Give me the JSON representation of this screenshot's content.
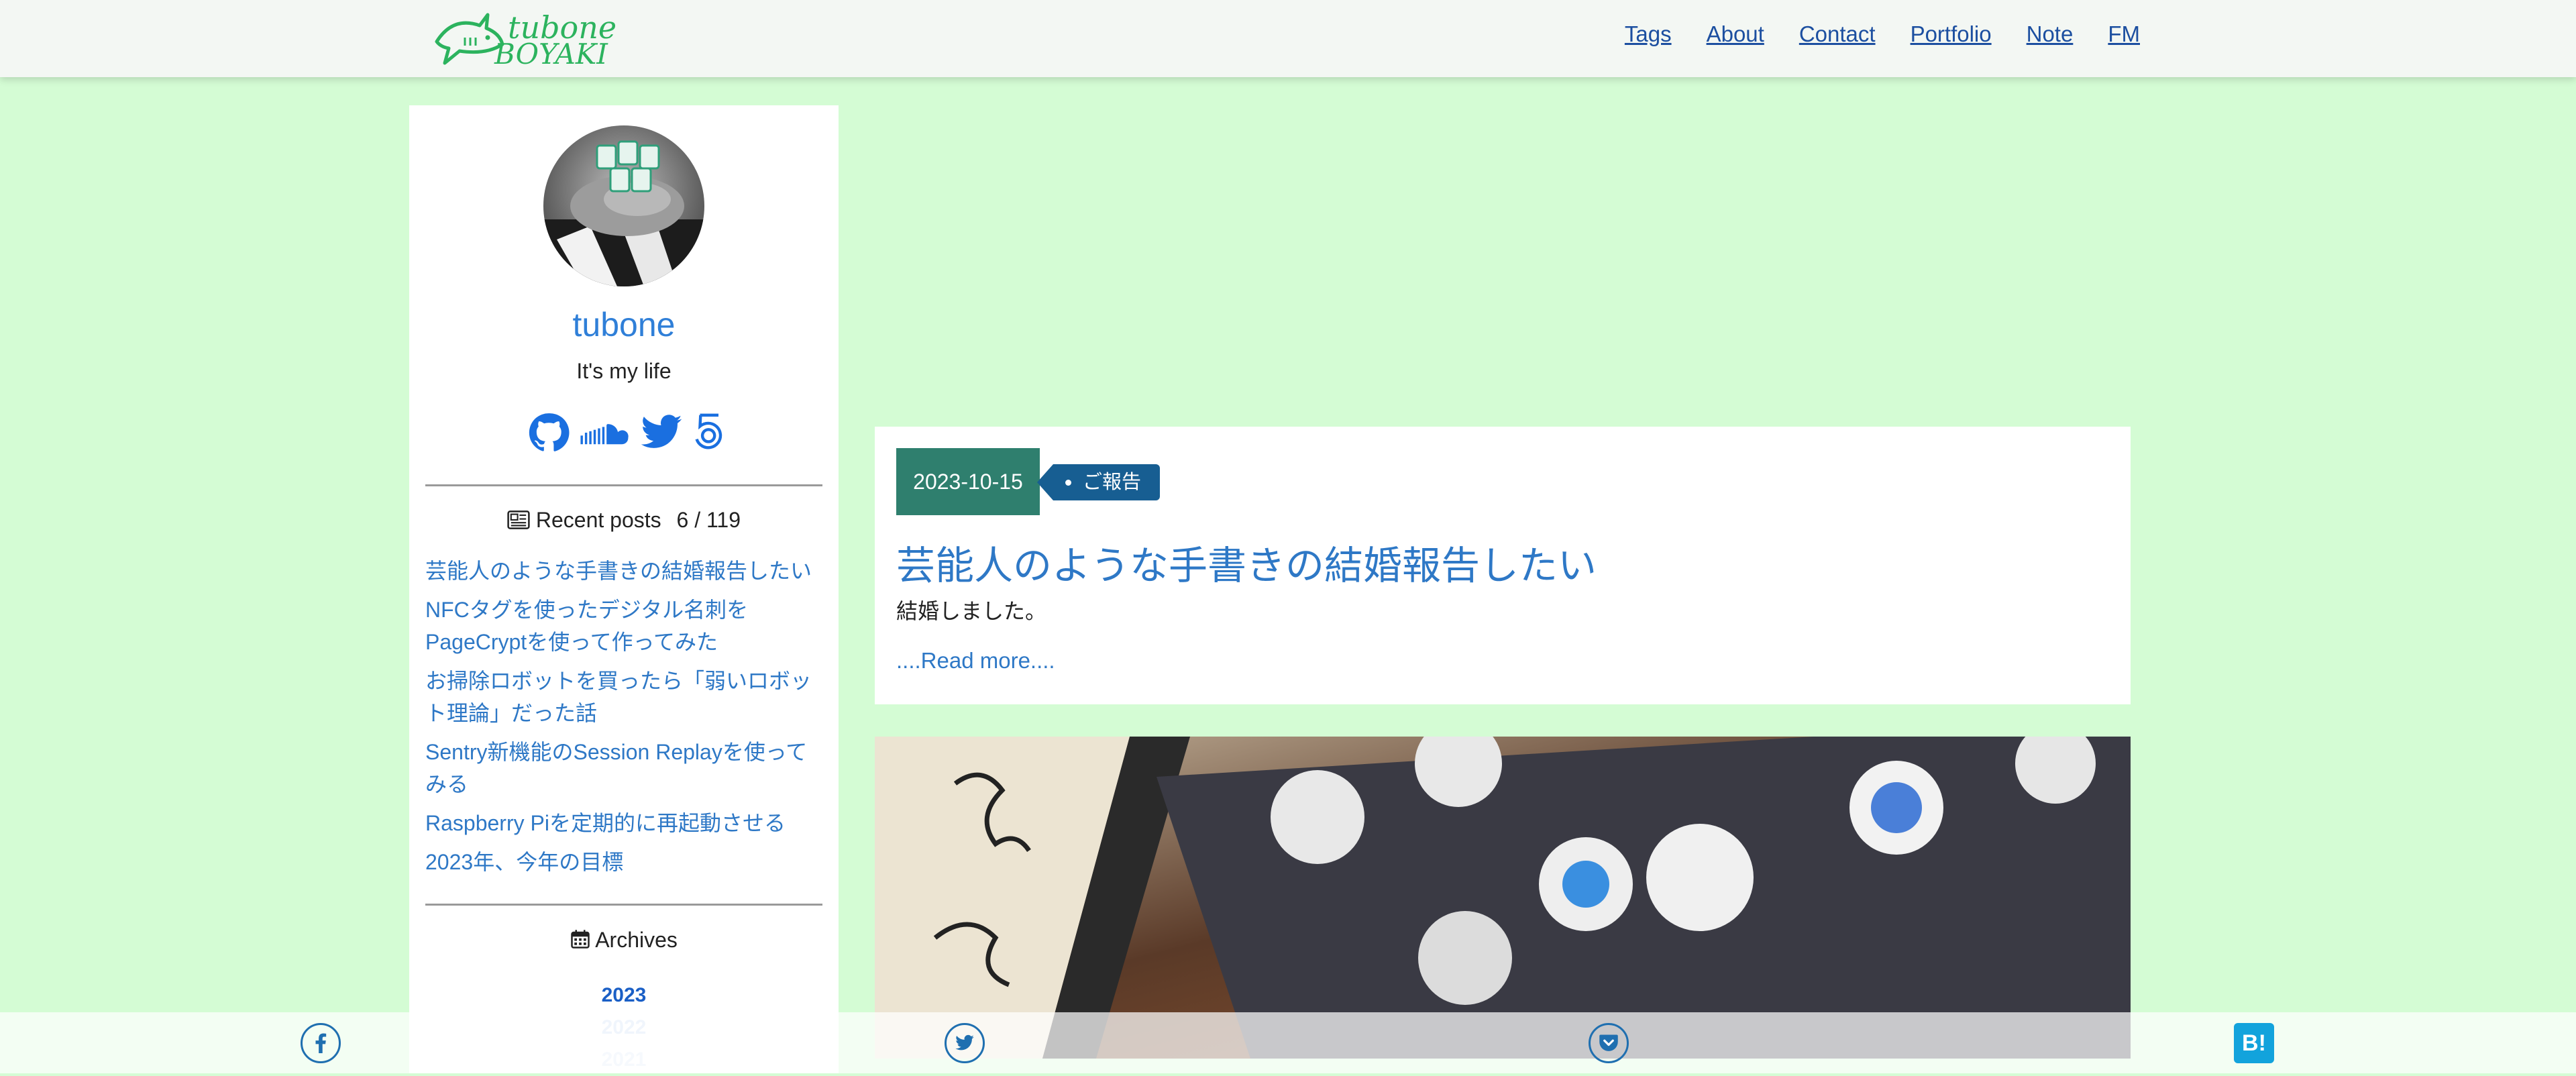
{
  "site": {
    "logo_line1": "tubone",
    "logo_line2": "BOYAKI"
  },
  "nav": {
    "items": [
      "Tags",
      "About",
      "Contact",
      "Portfolio",
      "Note",
      "FM"
    ]
  },
  "profile": {
    "name": "tubone",
    "description": "It's my life",
    "social_icons": [
      "github-icon",
      "soundcloud-icon",
      "twitter-icon",
      "500px-icon"
    ]
  },
  "recent": {
    "icon": "newspaper-icon",
    "title": "Recent posts",
    "count": "6 / 119",
    "items": [
      "芸能人のような手書きの結婚報告したい",
      "NFCタグを使ったデジタル名刺をPageCryptを使って作ってみた",
      "お掃除ロボットを買ったら「弱いロボット理論」だった話",
      "Sentry新機能のSession Replayを使ってみる",
      "Raspberry Piを定期的に再起動させる",
      "2023年、今年の目標"
    ]
  },
  "archives": {
    "icon": "calendar-icon",
    "title": "Archives",
    "years": [
      "2023",
      "2022",
      "2021"
    ]
  },
  "post": {
    "date": "2023-10-15",
    "tag": "ご報告",
    "title": "芸能人のような手書きの結婚報告したい",
    "excerpt": "結婚しました。",
    "read_more": "....Read more...."
  },
  "share": {
    "icons": [
      "facebook-icon",
      "twitter-icon",
      "pocket-icon"
    ],
    "hatena_label": "B!"
  },
  "colors": {
    "page_bg": "#d4fcd4",
    "link": "#2e78c6",
    "date_badge": "#2f7f6e",
    "tag_badge": "#175e92",
    "logo": "#2cb35e",
    "hatena": "#12a3dc"
  }
}
